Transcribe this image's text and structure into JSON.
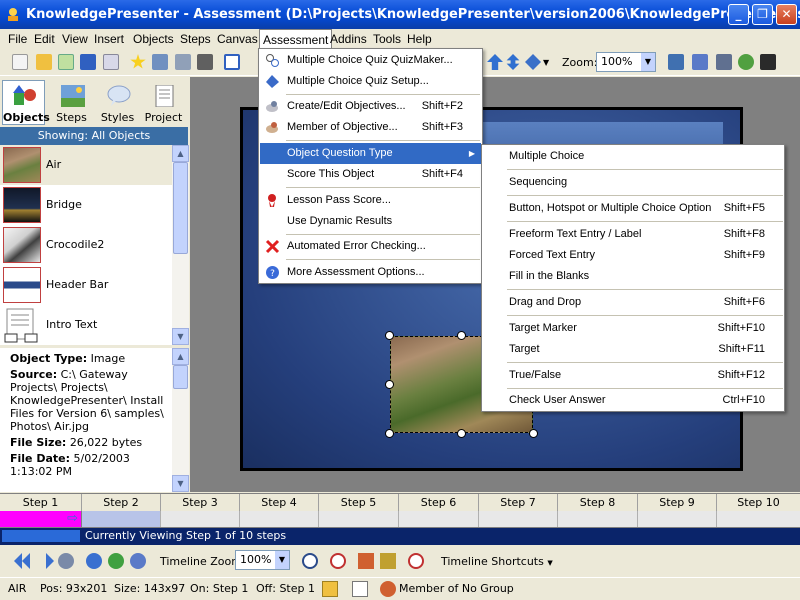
{
  "window": {
    "title": "KnowledgePresenter - Assessment (D:\\Projects\\KnowledgePresenter\\version2006\\KnowledgePresenter\\Assessm..."
  },
  "menubar": {
    "items": [
      "File",
      "Edit",
      "View",
      "Insert",
      "Objects",
      "Steps",
      "Canvas",
      "Assessment",
      "Addins",
      "Tools",
      "Help"
    ],
    "active": "Assessment"
  },
  "toolbar": {
    "zoom_label": "Zoom:",
    "zoom_value": "100%"
  },
  "left_panel": {
    "tabs": [
      "Objects",
      "Steps",
      "Styles",
      "Project"
    ],
    "active_tab": "Objects",
    "showing": "Showing: All Objects",
    "objects": [
      "Air",
      "Bridge",
      "Crocodile2",
      "Header Bar",
      "Intro Text"
    ],
    "selected": "Air",
    "properties": {
      "object_type_label": "Object Type:",
      "object_type": "Image",
      "source_label": "Source:",
      "source": "C:\\ Gateway Projects\\ Projects\\ KnowledgePresenter\\ Install Files for Version 6\\ samples\\ Photos\\ Air.jpg",
      "file_size_label": "File Size:",
      "file_size": "26,022 bytes",
      "file_date_label": "File Date:",
      "file_date": "5/02/2003 1:13:02 PM"
    }
  },
  "assessment_menu": {
    "items": [
      {
        "label": "Multiple Choice Quiz QuizMaker...",
        "shortcut": "",
        "icon": "quizmaker-icon"
      },
      {
        "label": "Multiple Choice Quiz Setup...",
        "shortcut": "",
        "icon": "quiz-setup-icon"
      },
      {
        "label": "Create/Edit Objectives...",
        "shortcut": "Shift+F2",
        "icon": "objectives-icon"
      },
      {
        "label": "Member of Objective...",
        "shortcut": "Shift+F3",
        "icon": "member-objective-icon"
      },
      {
        "label": "Object Question Type",
        "shortcut": "",
        "icon": ""
      },
      {
        "label": "Score This Object",
        "shortcut": "Shift+F4",
        "icon": ""
      },
      {
        "label": "Lesson Pass Score...",
        "shortcut": "",
        "icon": "ribbon-icon"
      },
      {
        "label": "Use Dynamic Results",
        "shortcut": "",
        "icon": ""
      },
      {
        "label": "Automated Error Checking...",
        "shortcut": "",
        "icon": "error-check-icon"
      },
      {
        "label": "More Assessment Options...",
        "shortcut": "",
        "icon": "help-icon"
      }
    ],
    "highlighted": "Object Question Type"
  },
  "question_type_submenu": {
    "items": [
      {
        "label": "Multiple Choice",
        "shortcut": ""
      },
      {
        "label": "Sequencing",
        "shortcut": ""
      },
      {
        "label": "Button, Hotspot or Multiple Choice Option",
        "shortcut": "Shift+F5"
      },
      {
        "label": "Freeform Text Entry / Label",
        "shortcut": "Shift+F8"
      },
      {
        "label": "Forced Text Entry",
        "shortcut": "Shift+F9"
      },
      {
        "label": "Fill in the Blanks",
        "shortcut": ""
      },
      {
        "label": "Drag and Drop",
        "shortcut": "Shift+F6"
      },
      {
        "label": "Target Marker",
        "shortcut": "Shift+F10"
      },
      {
        "label": "Target",
        "shortcut": "Shift+F11"
      },
      {
        "label": "True/False",
        "shortcut": "Shift+F12"
      },
      {
        "label": "Check User Answer",
        "shortcut": "Ctrl+F10"
      }
    ]
  },
  "timeline": {
    "steps": [
      "Step 1",
      "Step 2",
      "Step 3",
      "Step 4",
      "Step 5",
      "Step 6",
      "Step 7",
      "Step 8",
      "Step 9",
      "Step 10"
    ],
    "current_step": "Step 1",
    "status": "Currently Viewing Step 1 of 10 steps",
    "zoom_label": "Timeline Zoom:",
    "zoom_value": "100%",
    "shortcuts_label": "Timeline Shortcuts"
  },
  "statusbar": {
    "name": "AIR",
    "pos": "Pos: 93x201",
    "size": "Size: 143x97",
    "on": "On: Step 1",
    "off": "Off: Step 1",
    "group": "Member of No Group"
  }
}
